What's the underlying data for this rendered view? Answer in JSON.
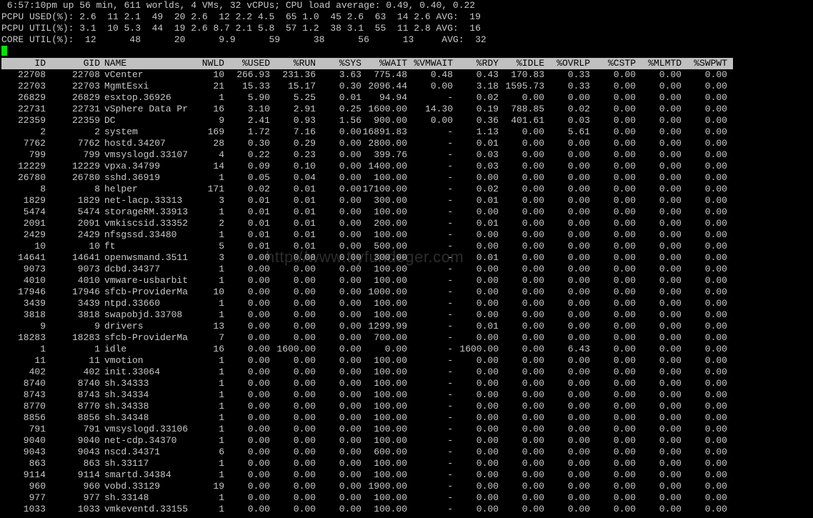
{
  "summary": {
    "line1": " 6:57:10pm up 56 min, 611 worlds, 4 VMs, 32 vCPUs; CPU load average: 0.49, 0.40, 0.22",
    "line2": "PCPU USED(%): 2.6  11 2.1  49  20 2.6  12 2.2 4.5  65 1.0  45 2.6  63  14 2.6 AVG:  19",
    "line3": "PCPU UTIL(%): 3.1  10 5.3  44  19 2.6 8.7 2.1 5.8  57 1.2  38 3.1  55  11 2.8 AVG:  16",
    "line4": "CORE UTIL(%):  12      48      20      9.9      59      38      56      13     AVG:  32"
  },
  "watermark": "http://www.ttyfundeger.com",
  "colors": {
    "background": "#000000",
    "text": "#c8c8c8",
    "header_bg": "#c0c0c0",
    "header_text": "#000000",
    "cursor": "#00e000"
  },
  "table": {
    "columns": [
      "ID",
      "GID",
      "NAME",
      "NWLD",
      "%USED",
      "%RUN",
      "%SYS",
      "%WAIT",
      "%VMWAIT",
      "%RDY",
      "%IDLE",
      "%OVRLP",
      "%CSTP",
      "%MLMTD",
      "%SWPWT"
    ],
    "rows": [
      [
        "22708",
        "22708",
        "vCenter",
        "10",
        "266.93",
        "231.36",
        "3.63",
        "775.48",
        "0.48",
        "0.43",
        "170.83",
        "0.33",
        "0.00",
        "0.00",
        "0.00"
      ],
      [
        "22703",
        "22703",
        "MgmtEsxi",
        "21",
        "15.33",
        "15.17",
        "0.30",
        "2096.44",
        "0.00",
        "3.18",
        "1595.73",
        "0.33",
        "0.00",
        "0.00",
        "0.00"
      ],
      [
        "26829",
        "26829",
        "esxtop.36926",
        "1",
        "5.90",
        "5.25",
        "0.01",
        "94.94",
        "-",
        "0.02",
        "0.00",
        "0.00",
        "0.00",
        "0.00",
        "0.00"
      ],
      [
        "22731",
        "22731",
        "vSphere Data Pr",
        "16",
        "3.10",
        "2.91",
        "0.25",
        "1600.00",
        "14.30",
        "0.19",
        "788.85",
        "0.02",
        "0.00",
        "0.00",
        "0.00"
      ],
      [
        "22359",
        "22359",
        "DC",
        "9",
        "2.41",
        "0.93",
        "1.56",
        "900.00",
        "0.00",
        "0.36",
        "401.61",
        "0.03",
        "0.00",
        "0.00",
        "0.00"
      ],
      [
        "2",
        "2",
        "system",
        "169",
        "1.72",
        "7.16",
        "0.00",
        "16891.83",
        "-",
        "1.13",
        "0.00",
        "5.61",
        "0.00",
        "0.00",
        "0.00"
      ],
      [
        "7762",
        "7762",
        "hostd.34207",
        "28",
        "0.30",
        "0.29",
        "0.00",
        "2800.00",
        "-",
        "0.01",
        "0.00",
        "0.00",
        "0.00",
        "0.00",
        "0.00"
      ],
      [
        "799",
        "799",
        "vmsyslogd.33107",
        "4",
        "0.22",
        "0.23",
        "0.00",
        "399.76",
        "-",
        "0.03",
        "0.00",
        "0.00",
        "0.00",
        "0.00",
        "0.00"
      ],
      [
        "12229",
        "12229",
        "vpxa.34799",
        "14",
        "0.09",
        "0.10",
        "0.00",
        "1400.00",
        "-",
        "0.03",
        "0.00",
        "0.00",
        "0.00",
        "0.00",
        "0.00"
      ],
      [
        "26780",
        "26780",
        "sshd.36919",
        "1",
        "0.05",
        "0.04",
        "0.00",
        "100.00",
        "-",
        "0.00",
        "0.00",
        "0.00",
        "0.00",
        "0.00",
        "0.00"
      ],
      [
        "8",
        "8",
        "helper",
        "171",
        "0.02",
        "0.01",
        "0.00",
        "17100.00",
        "-",
        "0.02",
        "0.00",
        "0.00",
        "0.00",
        "0.00",
        "0.00"
      ],
      [
        "1829",
        "1829",
        "net-lacp.33313",
        "3",
        "0.01",
        "0.01",
        "0.00",
        "300.00",
        "-",
        "0.01",
        "0.00",
        "0.00",
        "0.00",
        "0.00",
        "0.00"
      ],
      [
        "5474",
        "5474",
        "storageRM.33913",
        "1",
        "0.01",
        "0.01",
        "0.00",
        "100.00",
        "-",
        "0.00",
        "0.00",
        "0.00",
        "0.00",
        "0.00",
        "0.00"
      ],
      [
        "2091",
        "2091",
        "vmkiscsid.33352",
        "2",
        "0.01",
        "0.01",
        "0.00",
        "200.00",
        "-",
        "0.01",
        "0.00",
        "0.00",
        "0.00",
        "0.00",
        "0.00"
      ],
      [
        "2429",
        "2429",
        "nfsgssd.33480",
        "1",
        "0.01",
        "0.01",
        "0.00",
        "100.00",
        "-",
        "0.00",
        "0.00",
        "0.00",
        "0.00",
        "0.00",
        "0.00"
      ],
      [
        "10",
        "10",
        "ft",
        "5",
        "0.01",
        "0.01",
        "0.00",
        "500.00",
        "-",
        "0.00",
        "0.00",
        "0.00",
        "0.00",
        "0.00",
        "0.00"
      ],
      [
        "14641",
        "14641",
        "openwsmand.3511",
        "3",
        "0.00",
        "0.00",
        "0.00",
        "300.00",
        "-",
        "0.01",
        "0.00",
        "0.00",
        "0.00",
        "0.00",
        "0.00"
      ],
      [
        "9073",
        "9073",
        "dcbd.34377",
        "1",
        "0.00",
        "0.00",
        "0.00",
        "100.00",
        "-",
        "0.00",
        "0.00",
        "0.00",
        "0.00",
        "0.00",
        "0.00"
      ],
      [
        "4010",
        "4010",
        "vmware-usbarbit",
        "1",
        "0.00",
        "0.00",
        "0.00",
        "100.00",
        "-",
        "0.00",
        "0.00",
        "0.00",
        "0.00",
        "0.00",
        "0.00"
      ],
      [
        "17946",
        "17946",
        "sfcb-ProviderMa",
        "10",
        "0.00",
        "0.00",
        "0.00",
        "1000.00",
        "-",
        "0.00",
        "0.00",
        "0.00",
        "0.00",
        "0.00",
        "0.00"
      ],
      [
        "3439",
        "3439",
        "ntpd.33660",
        "1",
        "0.00",
        "0.00",
        "0.00",
        "100.00",
        "-",
        "0.00",
        "0.00",
        "0.00",
        "0.00",
        "0.00",
        "0.00"
      ],
      [
        "3818",
        "3818",
        "swapobjd.33708",
        "1",
        "0.00",
        "0.00",
        "0.00",
        "100.00",
        "-",
        "0.00",
        "0.00",
        "0.00",
        "0.00",
        "0.00",
        "0.00"
      ],
      [
        "9",
        "9",
        "drivers",
        "13",
        "0.00",
        "0.00",
        "0.00",
        "1299.99",
        "-",
        "0.01",
        "0.00",
        "0.00",
        "0.00",
        "0.00",
        "0.00"
      ],
      [
        "18283",
        "18283",
        "sfcb-ProviderMa",
        "7",
        "0.00",
        "0.00",
        "0.00",
        "700.00",
        "-",
        "0.00",
        "0.00",
        "0.00",
        "0.00",
        "0.00",
        "0.00"
      ],
      [
        "1",
        "1",
        "idle",
        "16",
        "0.00",
        "1600.00",
        "0.00",
        "0.00",
        "-",
        "1600.00",
        "0.00",
        "6.43",
        "0.00",
        "0.00",
        "0.00"
      ],
      [
        "11",
        "11",
        "vmotion",
        "1",
        "0.00",
        "0.00",
        "0.00",
        "100.00",
        "-",
        "0.00",
        "0.00",
        "0.00",
        "0.00",
        "0.00",
        "0.00"
      ],
      [
        "402",
        "402",
        "init.33064",
        "1",
        "0.00",
        "0.00",
        "0.00",
        "100.00",
        "-",
        "0.00",
        "0.00",
        "0.00",
        "0.00",
        "0.00",
        "0.00"
      ],
      [
        "8740",
        "8740",
        "sh.34333",
        "1",
        "0.00",
        "0.00",
        "0.00",
        "100.00",
        "-",
        "0.00",
        "0.00",
        "0.00",
        "0.00",
        "0.00",
        "0.00"
      ],
      [
        "8743",
        "8743",
        "sh.34334",
        "1",
        "0.00",
        "0.00",
        "0.00",
        "100.00",
        "-",
        "0.00",
        "0.00",
        "0.00",
        "0.00",
        "0.00",
        "0.00"
      ],
      [
        "8770",
        "8770",
        "sh.34338",
        "1",
        "0.00",
        "0.00",
        "0.00",
        "100.00",
        "-",
        "0.00",
        "0.00",
        "0.00",
        "0.00",
        "0.00",
        "0.00"
      ],
      [
        "8856",
        "8856",
        "sh.34348",
        "1",
        "0.00",
        "0.00",
        "0.00",
        "100.00",
        "-",
        "0.00",
        "0.00",
        "0.00",
        "0.00",
        "0.00",
        "0.00"
      ],
      [
        "791",
        "791",
        "vmsyslogd.33106",
        "1",
        "0.00",
        "0.00",
        "0.00",
        "100.00",
        "-",
        "0.00",
        "0.00",
        "0.00",
        "0.00",
        "0.00",
        "0.00"
      ],
      [
        "9040",
        "9040",
        "net-cdp.34370",
        "1",
        "0.00",
        "0.00",
        "0.00",
        "100.00",
        "-",
        "0.00",
        "0.00",
        "0.00",
        "0.00",
        "0.00",
        "0.00"
      ],
      [
        "9043",
        "9043",
        "nscd.34371",
        "6",
        "0.00",
        "0.00",
        "0.00",
        "600.00",
        "-",
        "0.00",
        "0.00",
        "0.00",
        "0.00",
        "0.00",
        "0.00"
      ],
      [
        "863",
        "863",
        "sh.33117",
        "1",
        "0.00",
        "0.00",
        "0.00",
        "100.00",
        "-",
        "0.00",
        "0.00",
        "0.00",
        "0.00",
        "0.00",
        "0.00"
      ],
      [
        "9114",
        "9114",
        "smartd.34384",
        "1",
        "0.00",
        "0.00",
        "0.00",
        "100.00",
        "-",
        "0.00",
        "0.00",
        "0.00",
        "0.00",
        "0.00",
        "0.00"
      ],
      [
        "960",
        "960",
        "vobd.33129",
        "19",
        "0.00",
        "0.00",
        "0.00",
        "1900.00",
        "-",
        "0.00",
        "0.00",
        "0.00",
        "0.00",
        "0.00",
        "0.00"
      ],
      [
        "977",
        "977",
        "sh.33148",
        "1",
        "0.00",
        "0.00",
        "0.00",
        "100.00",
        "-",
        "0.00",
        "0.00",
        "0.00",
        "0.00",
        "0.00",
        "0.00"
      ],
      [
        "1033",
        "1033",
        "vmkeventd.33155",
        "1",
        "0.00",
        "0.00",
        "0.00",
        "100.00",
        "-",
        "0.00",
        "0.00",
        "0.00",
        "0.00",
        "0.00",
        "0.00"
      ]
    ]
  }
}
